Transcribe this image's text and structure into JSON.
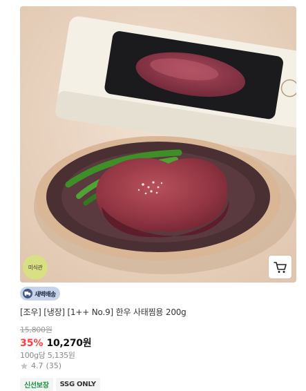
{
  "product": {
    "badge_gourmet": "미식관",
    "delivery_badge": "새벽배송",
    "title": "[조우] [냉장] [1++ No.9] 한우 사태찜용 200g",
    "original_price": "15,800원",
    "discount": "35%",
    "sale_price": "10,270원",
    "unit_price": "100g당 5,135원",
    "rating": "4.7",
    "review_count": "(35)",
    "tags": [
      "신선보장",
      "SSG ONLY"
    ]
  },
  "icons": {
    "cart": "cart-icon",
    "truck": "truck-icon",
    "star": "star-icon"
  },
  "colors": {
    "discount": "#ff3d3d",
    "fresh_tag": "#17913b",
    "dawn_badge_bg": "#c7d3e9",
    "gourmet_badge_bg": "#d9df83"
  }
}
